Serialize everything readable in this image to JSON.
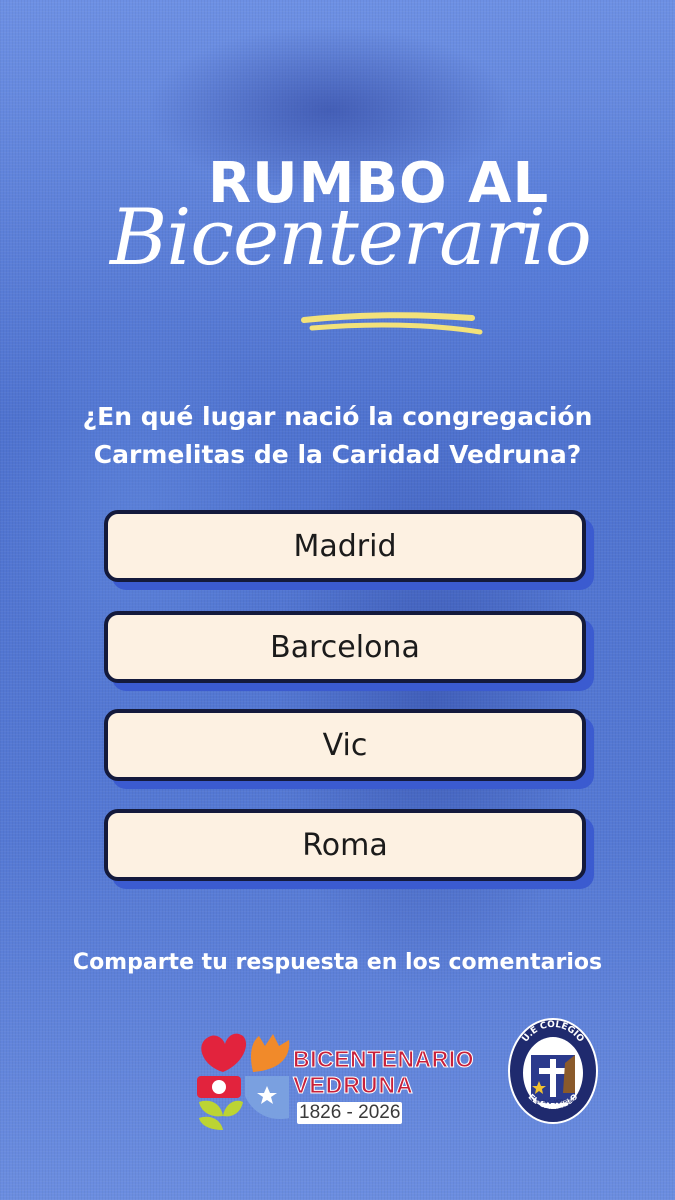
{
  "title": {
    "line1": "RUMBO AL",
    "line2": "Bicenterario"
  },
  "question": "¿En qué lugar nació la congregación Carmelitas de la Caridad Vedruna?",
  "options": [
    {
      "label": "Madrid"
    },
    {
      "label": "Barcelona"
    },
    {
      "label": "Vic"
    },
    {
      "label": "Roma"
    }
  ],
  "footer": "Comparte tu respuesta en los comentarios",
  "logos": {
    "bicentenario": {
      "word1": "BICENTENARIO",
      "word2": "VEDRUNA",
      "years": "1826 - 2026"
    },
    "school": {
      "top_text": "U.E COLEGIO",
      "bottom_text": "EL CARMELO",
      "cross_text": "C. de la C. VEDRUNA"
    }
  },
  "colors": {
    "background": "#5b7fd6",
    "option_fill": "#fdf1e2",
    "option_border": "#141a3c",
    "option_shadow": "#3b5bd0",
    "underline": "#f3e27a",
    "text": "#ffffff"
  }
}
